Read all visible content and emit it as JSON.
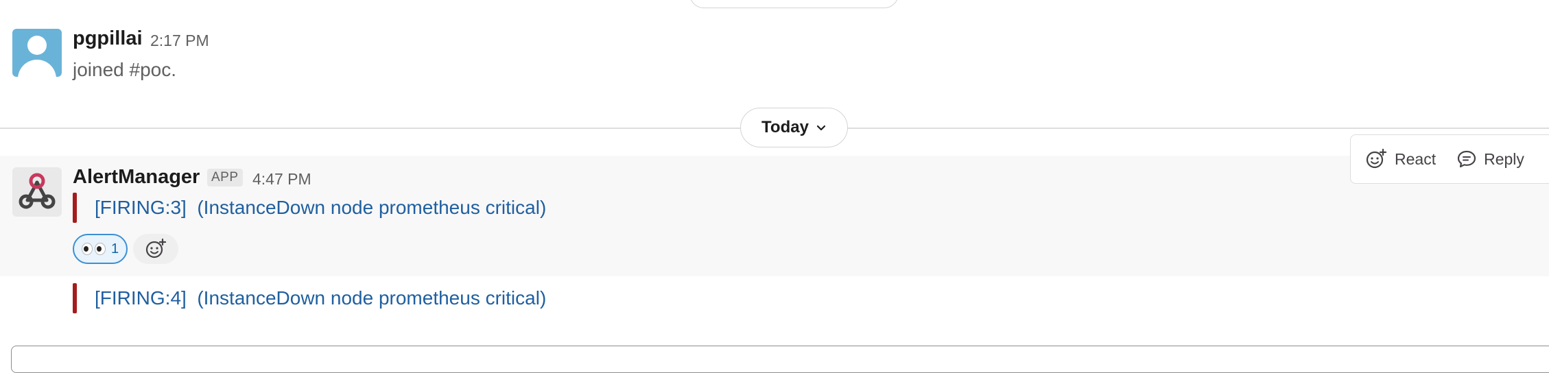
{
  "messages": [
    {
      "author": "pgpillai",
      "time": "2:17 PM",
      "text": "joined #poc."
    },
    {
      "author": "AlertManager",
      "badge": "APP",
      "time": "4:47 PM",
      "alerts": [
        {
          "status": "[FIRING:3]",
          "summary": "(InstanceDown node prometheus critical)"
        },
        {
          "status": "[FIRING:4]",
          "summary": "(InstanceDown node prometheus critical)"
        }
      ],
      "reactions": [
        {
          "emoji": "eyes",
          "count": "1"
        }
      ]
    }
  ],
  "divider": {
    "label": "Today"
  },
  "message_actions": {
    "react": "React",
    "reply": "Reply"
  },
  "colors": {
    "link": "#1f5fa0",
    "alert_bar": "#a51c1c",
    "reaction_border": "#3b8fd3",
    "hover_bg": "#f8f8f8"
  },
  "icons": [
    "chevron-down-icon",
    "add-reaction-icon",
    "reply-icon",
    "webhook-icon",
    "eyes-emoji-icon"
  ]
}
